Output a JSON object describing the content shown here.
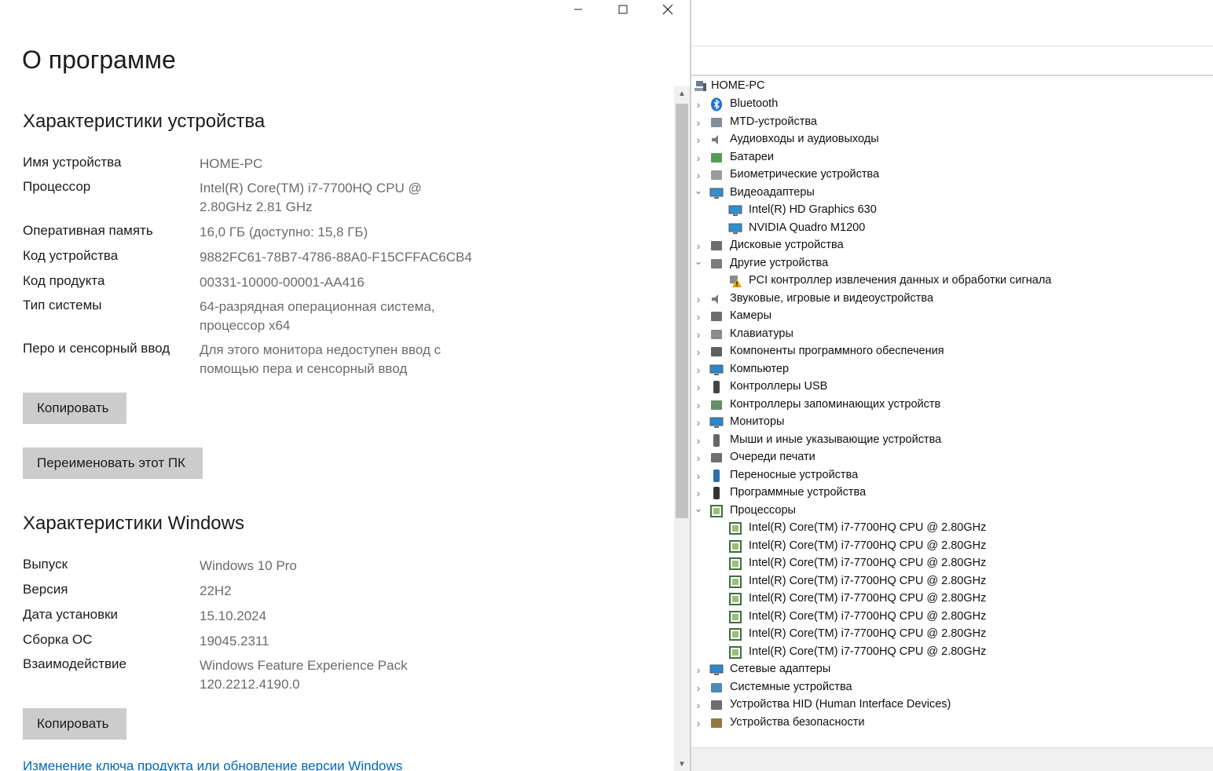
{
  "settings": {
    "title": "О программе",
    "device_section": {
      "title": "Характеристики устройства",
      "rows": [
        {
          "label": "Имя устройства",
          "value": "HOME-PC"
        },
        {
          "label": "Процессор",
          "value": "Intel(R) Core(TM) i7-7700HQ CPU @ 2.80GHz   2.81 GHz"
        },
        {
          "label": "Оперативная память",
          "value": "16,0 ГБ (доступно: 15,8 ГБ)"
        },
        {
          "label": "Код устройства",
          "value": "9882FC61-78B7-4786-88A0-F15CFFAC6CB4"
        },
        {
          "label": "Код продукта",
          "value": "00331-10000-00001-AA416"
        },
        {
          "label": "Тип системы",
          "value": "64-разрядная операционная система, процессор x64"
        },
        {
          "label": "Перо и сенсорный ввод",
          "value": "Для этого монитора недоступен ввод с помощью пера и сенсорный ввод"
        }
      ],
      "copy_label": "Копировать",
      "rename_label": "Переименовать этот ПК"
    },
    "windows_section": {
      "title": "Характеристики Windows",
      "rows": [
        {
          "label": "Выпуск",
          "value": "Windows 10 Pro"
        },
        {
          "label": "Версия",
          "value": "22H2"
        },
        {
          "label": "Дата установки",
          "value": "15.10.2024"
        },
        {
          "label": "Сборка ОС",
          "value": "19045.2311"
        },
        {
          "label": "Взаимодействие",
          "value": "Windows Feature Experience Pack 120.2212.4190.0"
        }
      ],
      "copy_label": "Копировать"
    },
    "link_change_key": "Изменение ключа продукта или обновление версии Windows"
  },
  "device_manager": {
    "root": "HOME-PC",
    "items": [
      {
        "label": "Bluetooth",
        "icon": "bluetooth-icon"
      },
      {
        "label": "MTD-устройства",
        "icon": "mtd-icon"
      },
      {
        "label": "Аудиовходы и аудиовыходы",
        "icon": "speaker-icon"
      },
      {
        "label": "Батареи",
        "icon": "battery-icon"
      },
      {
        "label": "Биометрические устройства",
        "icon": "fingerprint-icon"
      },
      {
        "label": "Видеоадаптеры",
        "icon": "display-adapter-icon"
      },
      {
        "label": "Intel(R) HD Graphics 630",
        "icon": "display-adapter-icon"
      },
      {
        "label": "NVIDIA Quadro M1200",
        "icon": "display-adapter-icon"
      },
      {
        "label": "Дисковые устройства",
        "icon": "disk-icon"
      },
      {
        "label": "Другие устройства",
        "icon": "unknown-device-icon"
      },
      {
        "label": "PCI контроллер извлечения данных и обработки сигнала",
        "icon": "warning-device-icon"
      },
      {
        "label": "Звуковые, игровые и видеоустройства",
        "icon": "speaker-icon"
      },
      {
        "label": "Камеры",
        "icon": "camera-icon"
      },
      {
        "label": "Клавиатуры",
        "icon": "keyboard-icon"
      },
      {
        "label": "Компоненты программного обеспечения",
        "icon": "software-component-icon"
      },
      {
        "label": "Компьютер",
        "icon": "computer-icon"
      },
      {
        "label": "Контроллеры USB",
        "icon": "usb-icon"
      },
      {
        "label": "Контроллеры запоминающих устройств",
        "icon": "storage-controller-icon"
      },
      {
        "label": "Мониторы",
        "icon": "monitor-icon"
      },
      {
        "label": "Мыши и иные указывающие устройства",
        "icon": "mouse-icon"
      },
      {
        "label": "Очереди печати",
        "icon": "printer-icon"
      },
      {
        "label": "Переносные устройства",
        "icon": "portable-device-icon"
      },
      {
        "label": "Программные устройства",
        "icon": "software-device-icon"
      },
      {
        "label": "Процессоры",
        "icon": "processor-icon"
      },
      {
        "label": "Intel(R) Core(TM) i7-7700HQ CPU @ 2.80GHz",
        "icon": "processor-icon"
      },
      {
        "label": "Intel(R) Core(TM) i7-7700HQ CPU @ 2.80GHz",
        "icon": "processor-icon"
      },
      {
        "label": "Intel(R) Core(TM) i7-7700HQ CPU @ 2.80GHz",
        "icon": "processor-icon"
      },
      {
        "label": "Intel(R) Core(TM) i7-7700HQ CPU @ 2.80GHz",
        "icon": "processor-icon"
      },
      {
        "label": "Intel(R) Core(TM) i7-7700HQ CPU @ 2.80GHz",
        "icon": "processor-icon"
      },
      {
        "label": "Intel(R) Core(TM) i7-7700HQ CPU @ 2.80GHz",
        "icon": "processor-icon"
      },
      {
        "label": "Intel(R) Core(TM) i7-7700HQ CPU @ 2.80GHz",
        "icon": "processor-icon"
      },
      {
        "label": "Intel(R) Core(TM) i7-7700HQ CPU @ 2.80GHz",
        "icon": "processor-icon"
      },
      {
        "label": "Сетевые адаптеры",
        "icon": "network-adapter-icon"
      },
      {
        "label": "Системные устройства",
        "icon": "system-device-icon"
      },
      {
        "label": "Устройства HID (Human Interface Devices)",
        "icon": "hid-icon"
      },
      {
        "label": "Устройства безопасности",
        "icon": "security-device-icon"
      }
    ]
  }
}
